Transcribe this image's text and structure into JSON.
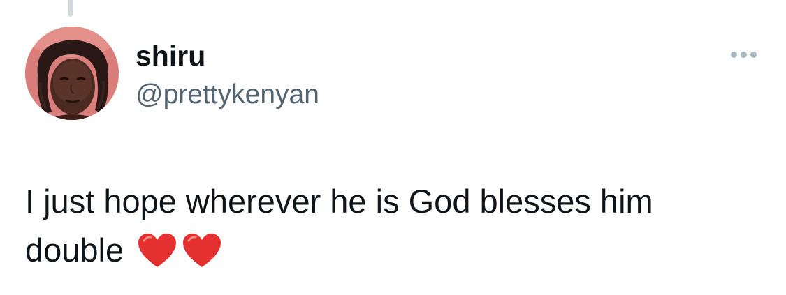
{
  "author": {
    "display_name": "shiru",
    "handle": "@prettykenyan",
    "avatar_icon": "avatar-photo"
  },
  "tweet": {
    "text_line_1": "I just hope wherever he is God blesses him",
    "text_line_2": "double",
    "emojis": [
      "red-heart-icon",
      "red-heart-icon"
    ]
  },
  "actions": {
    "more_icon": "more-options-icon"
  },
  "colors": {
    "text_primary": "#0f1419",
    "text_secondary": "#536471",
    "more_dots": "#aab8c2",
    "heart": "#e4302f",
    "thread_line": "#cfd9de"
  }
}
